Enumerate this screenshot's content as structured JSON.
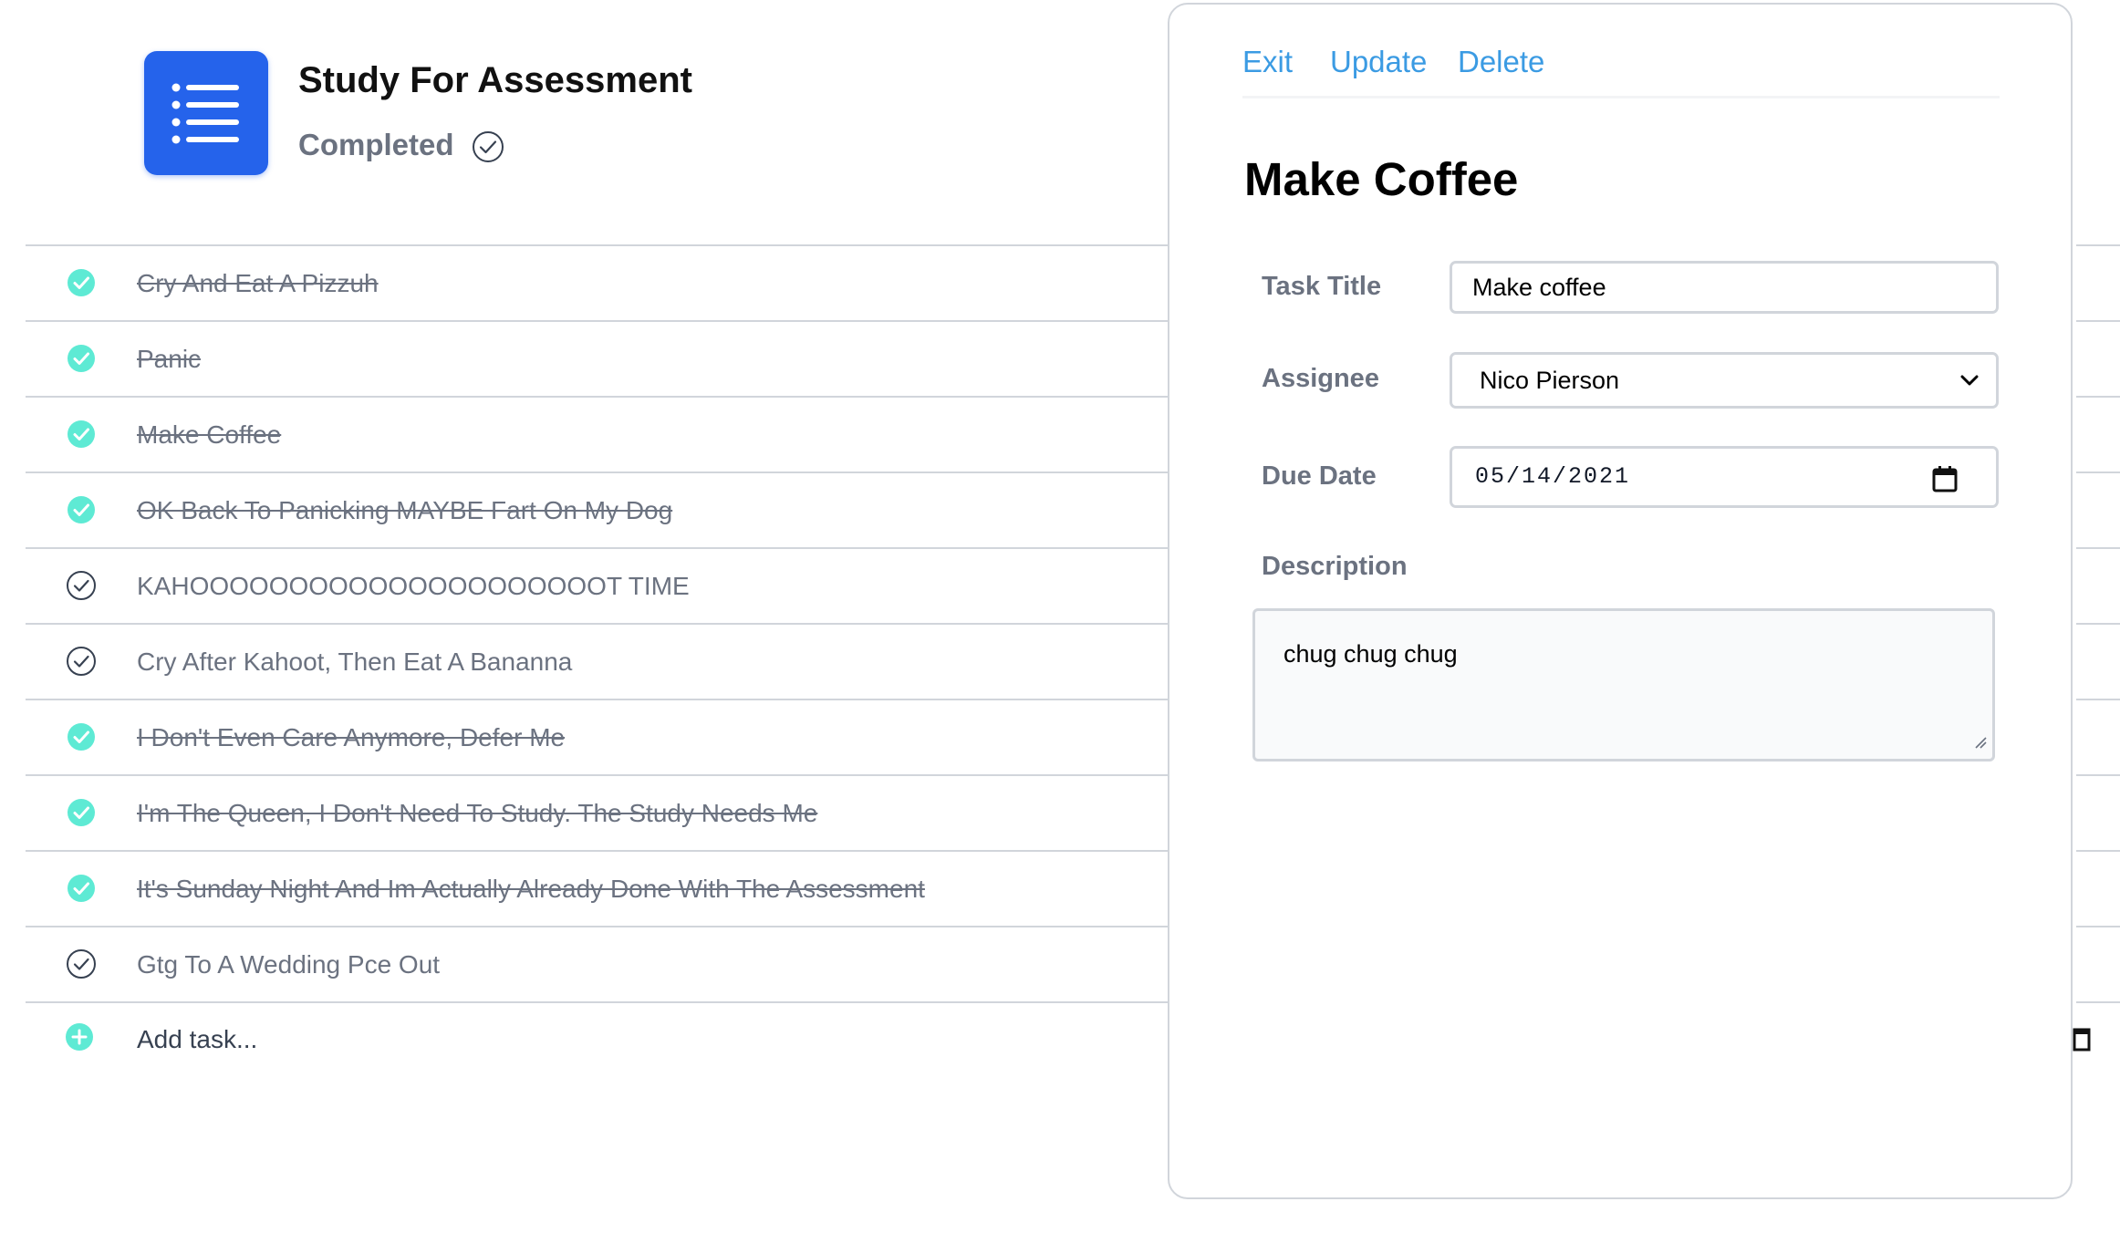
{
  "project": {
    "title": "Study For Assessment",
    "status": "Completed",
    "icon": "list-icon",
    "icon_color": "#2563eb"
  },
  "tasks": [
    {
      "label": "Cry And Eat A Pizzuh",
      "completed": true
    },
    {
      "label": "Panic",
      "completed": true
    },
    {
      "label": "Make Coffee",
      "completed": true
    },
    {
      "label": "OK Back To Panicking MAYBE Fart On My Dog",
      "completed": true
    },
    {
      "label": "KAHOOOOOOOOOOOOOOOOOOOOOT TIME",
      "completed": false
    },
    {
      "label": "Cry After Kahoot, Then Eat A Bananna",
      "completed": false
    },
    {
      "label": "I Don't Even Care Anymore, Defer Me",
      "completed": true
    },
    {
      "label": "I'm The Queen, I Don't Need To Study. The Study Needs Me",
      "completed": true
    },
    {
      "label": "It's Sunday Night And Im Actually Already Done With The Assessment",
      "completed": true
    },
    {
      "label": "Gtg To A Wedding Pce Out",
      "completed": false
    }
  ],
  "add_task": {
    "placeholder": "Add task..."
  },
  "colors": {
    "done": "#5eead4",
    "accent_link": "#3b9be3"
  },
  "detail": {
    "actions": {
      "exit": "Exit",
      "update": "Update",
      "delete": "Delete"
    },
    "title": "Make Coffee",
    "fields": {
      "task_title_label": "Task Title",
      "task_title_value": "Make coffee",
      "assignee_label": "Assignee",
      "assignee_value": "Nico Pierson",
      "due_date_label": "Due Date",
      "due_date_value": "05/14/2021",
      "description_label": "Description",
      "description_value": "chug chug chug"
    }
  }
}
